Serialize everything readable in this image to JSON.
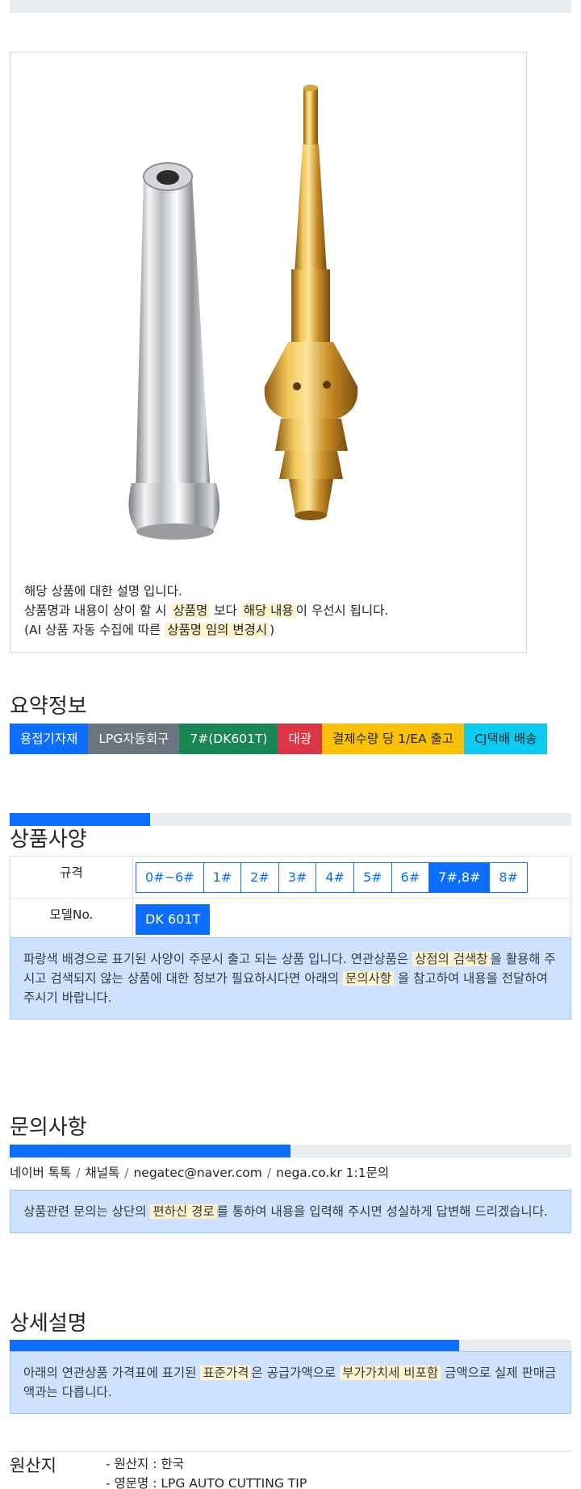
{
  "product_card": {
    "line1": "해당 상품에 대한 설명 입니다.",
    "line2": {
      "a": "상품명과 내용이 상이 할 시",
      "hl1": "상품명",
      "b": "보다",
      "hl2": "해당 내용",
      "c": "이 우선시 됩니다."
    },
    "line3": {
      "a": "(AI 상품 자동 수집에 따른",
      "hl": "상품명 임의 변경시",
      "b": ")"
    }
  },
  "summary": {
    "title": "요약정보",
    "badges": [
      {
        "label": "용접기자재",
        "color": "#0d6efd"
      },
      {
        "label": "LPG자동회구",
        "color": "#6c757d"
      },
      {
        "label": "7#(DK601T)",
        "color": "#198754"
      },
      {
        "label": "대광",
        "color": "#dc3545"
      },
      {
        "label": "결제수량 당 1/EA 출고",
        "color": "#ffc107"
      },
      {
        "label": "CJ택배 배송",
        "color": "#0dcaf0"
      }
    ]
  },
  "spec": {
    "title": "상품사양",
    "progress_percent": 25,
    "rows": [
      {
        "label": "규격",
        "options": [
          "0#~6#",
          "1#",
          "2#",
          "3#",
          "4#",
          "5#",
          "6#",
          "7#,8#",
          "8#"
        ],
        "selected": "7#,8#"
      },
      {
        "label": "모델No.",
        "options": [
          "DK 601T"
        ],
        "selected": "DK 601T"
      }
    ],
    "notice": {
      "a": "파랑색 배경으로 표기된 사양이 주문시 출고 되는 상품 입니다. 연관상품은",
      "hl1": "상점의 검색창",
      "b": "을 활용해 주시고 검색되지 않는 상품에 대한 정보가 필요하시다면 아래의",
      "hl2": "문의사항",
      "c": "을 참고하여 내용을 전달하여 주시기 바랍니다."
    }
  },
  "inquiry": {
    "title": "문의사항",
    "progress_percent": 50,
    "channels": [
      "네이버 톡톡",
      "채널톡",
      "negatec@naver.com",
      "nega.co.kr 1:1문의"
    ],
    "notice": {
      "a": "상품관련 문의는 상단의",
      "hl": "편하신 경로",
      "b": "를 통하여 내용을 입력해 주시면 성실하게 답변해 드리겠습니다."
    }
  },
  "detail": {
    "title": "상세설명",
    "progress_percent": 80,
    "notice": {
      "a": "아래의 연관상품 가격표에 표기된",
      "hl1": "표준가격",
      "b": "은 공급가액으로",
      "hl2": "부가가치세 비포함",
      "c": "금액으로 실제 판매금액과는 다릅니다."
    }
  },
  "origin": {
    "title": "원산지",
    "items": [
      "- 원산지 : 한국",
      "- 영문명 : LPG AUTO CUTTING TIP"
    ]
  }
}
